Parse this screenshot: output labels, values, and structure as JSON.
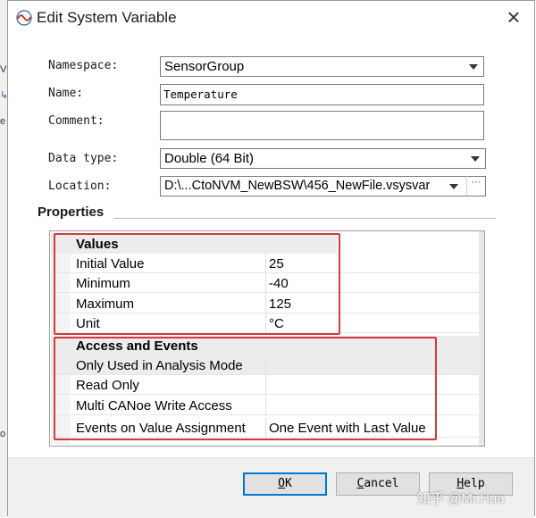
{
  "window": {
    "title": "Edit System Variable",
    "icon": "canoe-wave-icon"
  },
  "form": {
    "namespace_label": "Namespace:",
    "namespace_value": "SensorGroup",
    "name_label": "Name:",
    "name_value": "Temperature",
    "comment_label": "Comment:",
    "comment_value": "",
    "datatype_label": "Data type:",
    "datatype_value": "Double (64 Bit)",
    "location_label": "Location:",
    "location_value": "D:\\...CtoNVM_NewBSW\\456_NewFile.vsysvar",
    "location_browse": "···"
  },
  "properties": {
    "section_title": "Properties",
    "groups": [
      {
        "title": "Values",
        "rows": [
          {
            "name": "Initial Value",
            "value": "25"
          },
          {
            "name": "Minimum",
            "value": "-40"
          },
          {
            "name": "Maximum",
            "value": "125"
          },
          {
            "name": "Unit",
            "value": "°C"
          }
        ]
      },
      {
        "title": "Access and Events",
        "rows": [
          {
            "name": "Only Used in Analysis Mode",
            "value": ""
          },
          {
            "name": "Read Only",
            "value": ""
          },
          {
            "name": "Multi CANoe Write Access",
            "value": ""
          },
          {
            "name": "Events on Value Assignment",
            "value": "One Event with Last Value"
          }
        ]
      }
    ]
  },
  "buttons": {
    "ok_first": "O",
    "ok_rest": "K",
    "cancel_first": "C",
    "cancel_rest": "ancel",
    "help_first": "H",
    "help_rest": "elp"
  },
  "watermark": "知乎 @Mr.Hua",
  "colors": {
    "highlight_box": "#d23b3b",
    "default_button_border": "#0078d7"
  }
}
